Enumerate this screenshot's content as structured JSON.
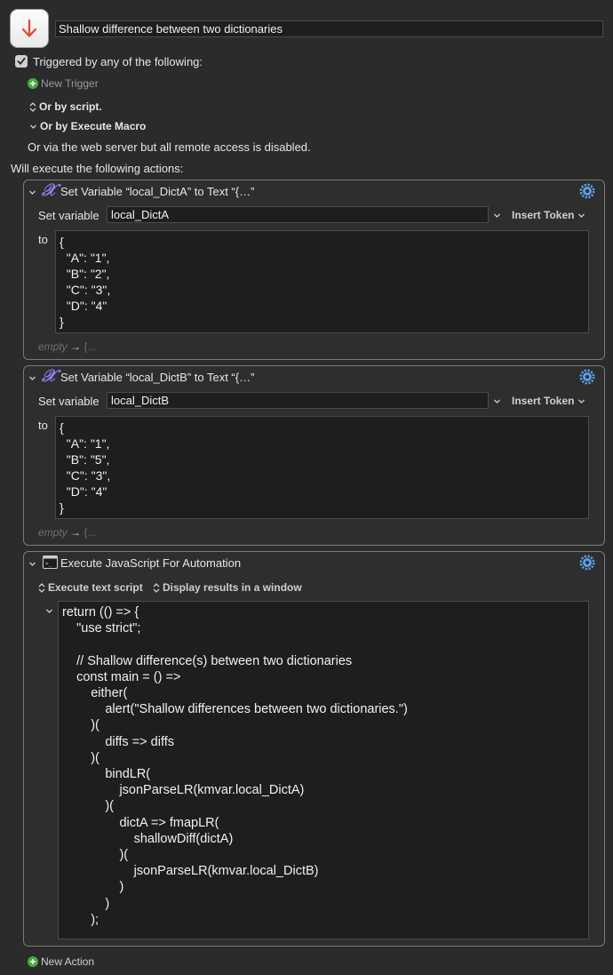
{
  "macro": {
    "title": "Shallow difference between two dictionaries",
    "icon": "arrow-down-icon",
    "accent": "#e5462d"
  },
  "triggers": {
    "enabled": true,
    "heading": "Triggered by any of the following:",
    "new_trigger": "New Trigger",
    "or_script": "Or by script.",
    "or_execute": "Or by Execute Macro",
    "web_server": "Or via the web server but all remote access is disabled."
  },
  "actions_heading": "Will execute the following actions:",
  "actions": [
    {
      "title": "Set Variable “local_DictA” to Text “{…”",
      "set_variable_label": "Set variable",
      "variable": "local_DictA",
      "insert_token": "Insert Token",
      "to_label": "to",
      "text": "{\n  \"A\": \"1\",\n  \"B\": \"2\",\n  \"C\": \"3\",\n  \"D\": \"4\"\n}",
      "footer_empty": "empty",
      "footer_arrow": "→",
      "footer_value": "{..."
    },
    {
      "title": "Set Variable “local_DictB” to Text “{…”",
      "set_variable_label": "Set variable",
      "variable": "local_DictB",
      "insert_token": "Insert Token",
      "to_label": "to",
      "text": "{\n  \"A\": \"1\",\n  \"B\": \"5\",\n  \"C\": \"3\",\n  \"D\": \"4\"\n}",
      "footer_empty": "empty",
      "footer_arrow": "→",
      "footer_value": "{..."
    },
    {
      "title": "Execute JavaScript For Automation",
      "option_source": "Execute text script",
      "option_results": "Display results in a window",
      "code": "return (() => {\n    \"use strict\";\n\n    // Shallow difference(s) between two dictionaries\n    const main = () =>\n        either(\n            alert(\"Shallow differences between two dictionaries.\")\n        )(\n            diffs => diffs\n        )(\n            bindLR(\n                jsonParseLR(kmvar.local_DictA)\n            )(\n                dictA => fmapLR(\n                    shallowDiff(dictA)\n                )(\n                    jsonParseLR(kmvar.local_DictB)\n                )\n            )\n        );"
    }
  ],
  "new_action": "New Action"
}
